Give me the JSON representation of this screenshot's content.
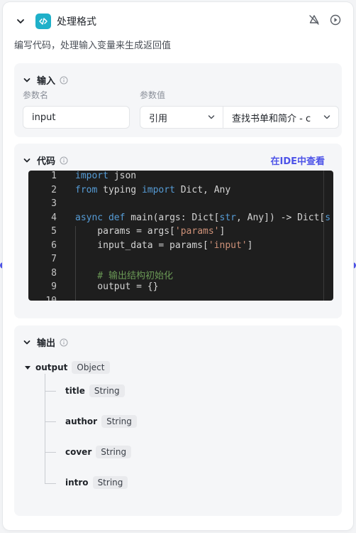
{
  "node": {
    "title": "处理格式",
    "description": "编写代码，处理输入变量来生成返回值"
  },
  "input_section": {
    "title": "输入",
    "param_name_label": "参数名",
    "param_value_label": "参数值",
    "param_name": "input",
    "value_type": "引用",
    "value_ref": "查找书单和简介 - c"
  },
  "code_section": {
    "title": "代码",
    "ide_link": "在IDE中查看",
    "lines": [
      {
        "n": "1",
        "segs": [
          [
            "kw",
            "import"
          ],
          [
            "t",
            " json"
          ]
        ]
      },
      {
        "n": "2",
        "segs": [
          [
            "kw",
            "from"
          ],
          [
            "t",
            " typing "
          ],
          [
            "kw",
            "import"
          ],
          [
            "t",
            " Dict, Any"
          ]
        ]
      },
      {
        "n": "3",
        "segs": []
      },
      {
        "n": "4",
        "segs": [
          [
            "kw",
            "async"
          ],
          [
            "t",
            " "
          ],
          [
            "kw",
            "def"
          ],
          [
            "t",
            " main(args: Dict["
          ],
          [
            "kw",
            "str"
          ],
          [
            "t",
            ", Any]) -> Dict["
          ],
          [
            "kw",
            "s"
          ]
        ]
      },
      {
        "n": "5",
        "segs": [
          [
            "t",
            "    params = args["
          ],
          [
            "str",
            "'params'"
          ],
          [
            "t",
            "]"
          ]
        ]
      },
      {
        "n": "6",
        "segs": [
          [
            "t",
            "    input_data = params["
          ],
          [
            "str",
            "'input'"
          ],
          [
            "t",
            "]"
          ]
        ]
      },
      {
        "n": "7",
        "segs": []
      },
      {
        "n": "8",
        "segs": [
          [
            "cm",
            "    # 输出结构初始化"
          ]
        ]
      },
      {
        "n": "9",
        "segs": [
          [
            "t",
            "    output = {}"
          ]
        ]
      },
      {
        "n": "10",
        "segs": []
      }
    ]
  },
  "output_section": {
    "title": "输出",
    "root": {
      "name": "output",
      "type": "Object"
    },
    "children": [
      {
        "name": "title",
        "type": "String"
      },
      {
        "name": "author",
        "type": "String"
      },
      {
        "name": "cover",
        "type": "String"
      },
      {
        "name": "intro",
        "type": "String"
      }
    ]
  },
  "colors": {
    "accent": "#4d53e8",
    "node_icon": "#1fb0c9",
    "editor_bg": "#1e1e1e"
  }
}
